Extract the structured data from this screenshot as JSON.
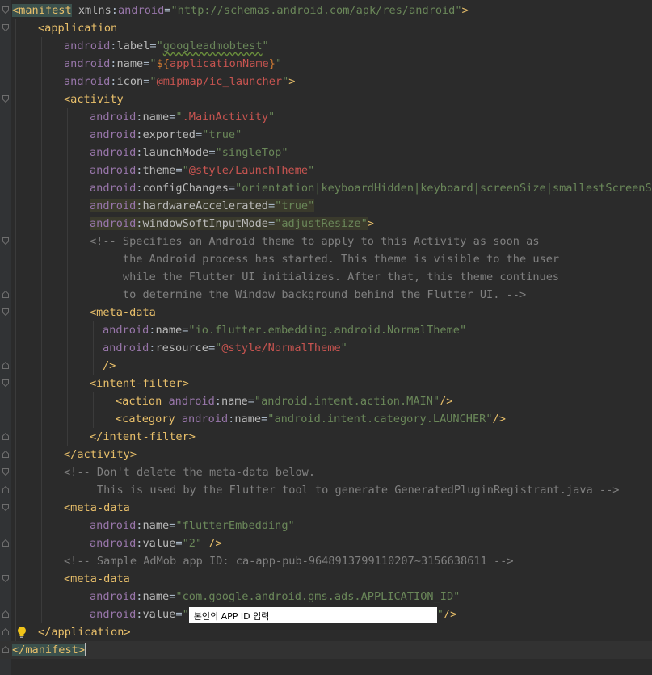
{
  "lines": [
    [
      [
        "tag",
        "<manifest",
        "hl"
      ],
      [
        "plain",
        " "
      ],
      [
        "attr",
        "xmlns"
      ],
      [
        "plain",
        ":"
      ],
      [
        "ns",
        "android"
      ],
      [
        "plain",
        "="
      ],
      [
        "val",
        "\"http://schemas.android.com/apk/res/android\""
      ],
      [
        "tag",
        ">"
      ]
    ],
    [
      [
        "tag",
        "<application"
      ]
    ],
    [
      [
        "ns",
        "android"
      ],
      [
        "plain",
        ":"
      ],
      [
        "attr",
        "label"
      ],
      [
        "plain",
        "="
      ],
      [
        "val",
        "\""
      ],
      [
        "val",
        "googleadmobtest",
        "sq"
      ],
      [
        "val",
        "\""
      ]
    ],
    [
      [
        "ns",
        "android"
      ],
      [
        "plain",
        ":"
      ],
      [
        "attr",
        "name"
      ],
      [
        "plain",
        "="
      ],
      [
        "val",
        "\""
      ],
      [
        "ref",
        "${"
      ],
      [
        "refv",
        "applicationName"
      ],
      [
        "ref",
        "}"
      ],
      [
        "val",
        "\""
      ]
    ],
    [
      [
        "ns",
        "android"
      ],
      [
        "plain",
        ":"
      ],
      [
        "attr",
        "icon"
      ],
      [
        "plain",
        "="
      ],
      [
        "val",
        "\""
      ],
      [
        "refv",
        "@mipmap/ic_launcher"
      ],
      [
        "val",
        "\""
      ],
      [
        "tag",
        ">"
      ]
    ],
    [
      [
        "tag",
        "<activity"
      ]
    ],
    [
      [
        "ns",
        "android"
      ],
      [
        "plain",
        ":"
      ],
      [
        "attr",
        "name"
      ],
      [
        "plain",
        "="
      ],
      [
        "val",
        "\""
      ],
      [
        "refv",
        ".MainActivity"
      ],
      [
        "val",
        "\""
      ]
    ],
    [
      [
        "ns",
        "android"
      ],
      [
        "plain",
        ":"
      ],
      [
        "attr",
        "exported"
      ],
      [
        "plain",
        "="
      ],
      [
        "val",
        "\"true\""
      ]
    ],
    [
      [
        "ns",
        "android"
      ],
      [
        "plain",
        ":"
      ],
      [
        "attr",
        "launchMode"
      ],
      [
        "plain",
        "="
      ],
      [
        "val",
        "\"singleTop\""
      ]
    ],
    [
      [
        "ns",
        "android"
      ],
      [
        "plain",
        ":"
      ],
      [
        "attr",
        "theme"
      ],
      [
        "plain",
        "="
      ],
      [
        "val",
        "\""
      ],
      [
        "refv",
        "@style/LaunchTheme"
      ],
      [
        "val",
        "\""
      ]
    ],
    [
      [
        "ns",
        "android"
      ],
      [
        "plain",
        ":"
      ],
      [
        "attr",
        "configChanges"
      ],
      [
        "plain",
        "="
      ],
      [
        "val",
        "\"orientation|keyboardHidden|keyboard|screenSize|smallestScreenSize|locale|layoutDirection|fontScale|screenLayout|density|uiMode\""
      ]
    ],
    [
      [
        "ns",
        "android",
        "ha"
      ],
      [
        "plain",
        ":",
        "ha"
      ],
      [
        "attr",
        "hardwareAccelerated",
        "ha"
      ],
      [
        "plain",
        "=",
        "ha"
      ],
      [
        "val",
        "\"true\"",
        "ha"
      ]
    ],
    [
      [
        "ns",
        "android",
        "ha"
      ],
      [
        "plain",
        ":",
        "ha"
      ],
      [
        "attr",
        "windowSoftInputMode",
        "ha"
      ],
      [
        "plain",
        "=",
        "ha"
      ],
      [
        "val",
        "\"adjustResize\"",
        "ha"
      ],
      [
        "tag",
        ">"
      ]
    ],
    [
      [
        "cmt",
        "<!-- Specifies an Android theme to apply to this Activity as soon as"
      ]
    ],
    [
      [
        "cmt",
        "     the Android process has started. This theme is visible to the user"
      ]
    ],
    [
      [
        "cmt",
        "     while the Flutter UI initializes. After that, this theme continues"
      ]
    ],
    [
      [
        "cmt",
        "     to determine the Window background behind the Flutter UI. -->"
      ]
    ],
    [
      [
        "tag",
        "<meta-data"
      ]
    ],
    [
      [
        "ns",
        "android"
      ],
      [
        "plain",
        ":"
      ],
      [
        "attr",
        "name"
      ],
      [
        "plain",
        "="
      ],
      [
        "val",
        "\"io.flutter.embedding.android.NormalTheme\""
      ]
    ],
    [
      [
        "ns",
        "android"
      ],
      [
        "plain",
        ":"
      ],
      [
        "attr",
        "resource"
      ],
      [
        "plain",
        "="
      ],
      [
        "val",
        "\""
      ],
      [
        "refv",
        "@style/NormalTheme"
      ],
      [
        "val",
        "\""
      ]
    ],
    [
      [
        "tag",
        "/>"
      ]
    ],
    [
      [
        "tag",
        "<intent-filter>"
      ]
    ],
    [
      [
        "tag",
        "<action"
      ],
      [
        "plain",
        " "
      ],
      [
        "ns",
        "android"
      ],
      [
        "plain",
        ":"
      ],
      [
        "attr",
        "name"
      ],
      [
        "plain",
        "="
      ],
      [
        "val",
        "\"android.intent.action.MAIN\""
      ],
      [
        "tag",
        "/>"
      ]
    ],
    [
      [
        "tag",
        "<category"
      ],
      [
        "plain",
        " "
      ],
      [
        "ns",
        "android"
      ],
      [
        "plain",
        ":"
      ],
      [
        "attr",
        "name"
      ],
      [
        "plain",
        "="
      ],
      [
        "val",
        "\"android.intent.category.LAUNCHER\""
      ],
      [
        "tag",
        "/>"
      ]
    ],
    [
      [
        "tag",
        "</intent-filter>"
      ]
    ],
    [
      [
        "tag",
        "</activity>"
      ]
    ],
    [
      [
        "cmt",
        "<!-- Don't delete the meta-data below."
      ]
    ],
    [
      [
        "cmt",
        "     This is used by the Flutter tool to generate GeneratedPluginRegistrant.java -->"
      ]
    ],
    [
      [
        "tag",
        "<meta-data"
      ]
    ],
    [
      [
        "ns",
        "android"
      ],
      [
        "plain",
        ":"
      ],
      [
        "attr",
        "name"
      ],
      [
        "plain",
        "="
      ],
      [
        "val",
        "\"flutterEmbedding\""
      ]
    ],
    [
      [
        "ns",
        "android"
      ],
      [
        "plain",
        ":"
      ],
      [
        "attr",
        "value"
      ],
      [
        "plain",
        "="
      ],
      [
        "val",
        "\"2\""
      ],
      [
        "plain",
        " "
      ],
      [
        "tag",
        "/>"
      ]
    ],
    [
      [
        "cmt",
        "<!-- Sample AdMob app ID: ca-app-pub-9648913799110207~3156638611 -->"
      ]
    ],
    [
      [
        "tag",
        "<meta-data"
      ]
    ],
    [
      [
        "ns",
        "android"
      ],
      [
        "plain",
        ":"
      ],
      [
        "attr",
        "name"
      ],
      [
        "plain",
        "="
      ],
      [
        "val",
        "\"com.google.android.gms.ads.APPLICATION_ID\""
      ]
    ],
    [
      [
        "ns",
        "android"
      ],
      [
        "plain",
        ":"
      ],
      [
        "attr",
        "value"
      ],
      [
        "plain",
        "="
      ],
      [
        "val",
        "\""
      ],
      [
        "redact",
        "본인의 APP ID 입력"
      ],
      [
        "val",
        "\""
      ],
      [
        "tag",
        "/>"
      ]
    ],
    [
      [
        "tag",
        "</application>"
      ]
    ],
    [
      [
        "tag",
        "</manifest",
        "hl"
      ],
      [
        "tag",
        ">",
        "hl"
      ],
      [
        "caret",
        ""
      ]
    ]
  ],
  "colors": {
    "background": "#2b2b2b",
    "gutter": "#313335",
    "tag": "#e8bf6a",
    "namespace": "#9876aa",
    "attribute": "#bababa",
    "string": "#6a8759",
    "reference": "#c75450",
    "comment": "#808080",
    "current_line": "#323232"
  },
  "icons": {
    "fold_marker": "fold-marker-icon",
    "intention": "lightbulb-icon"
  }
}
